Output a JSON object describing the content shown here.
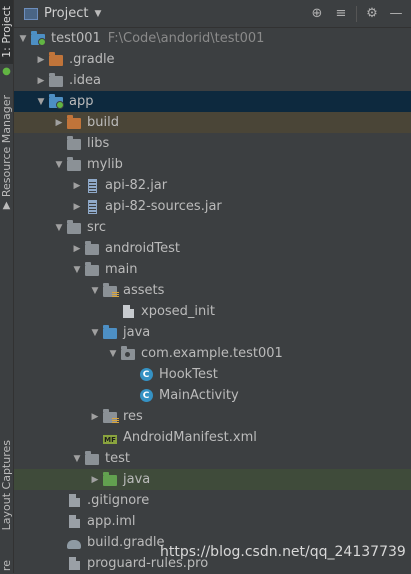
{
  "side_tabs": {
    "project": "1: Project",
    "resource_manager": "Resource Manager",
    "layout_captures": "Layout Captures",
    "bottom_cut": "re"
  },
  "header": {
    "title": "Project"
  },
  "tree": [
    {
      "label": "test001",
      "path": "F:\\Code\\andorid\\test001",
      "depth": 0,
      "arrow": "down",
      "icon": "module-folder-icon",
      "label_class": ""
    },
    {
      "label": ".gradle",
      "depth": 1,
      "arrow": "right",
      "icon": "folder-orange"
    },
    {
      "label": ".idea",
      "depth": 1,
      "arrow": "right",
      "icon": "folder-grey"
    },
    {
      "label": "app",
      "depth": 1,
      "arrow": "down",
      "icon": "module-folder-icon",
      "selected": true
    },
    {
      "label": "build",
      "depth": 2,
      "arrow": "right",
      "icon": "folder-orange",
      "highlight": "brown"
    },
    {
      "label": "libs",
      "depth": 2,
      "arrow": "",
      "icon": "folder-grey"
    },
    {
      "label": "mylib",
      "depth": 2,
      "arrow": "down",
      "icon": "folder-grey"
    },
    {
      "label": "api-82.jar",
      "depth": 3,
      "arrow": "right",
      "icon": "jar"
    },
    {
      "label": "api-82-sources.jar",
      "depth": 3,
      "arrow": "right",
      "icon": "jar"
    },
    {
      "label": "src",
      "depth": 2,
      "arrow": "down",
      "icon": "folder-grey"
    },
    {
      "label": "androidTest",
      "depth": 3,
      "arrow": "right",
      "icon": "folder-grey"
    },
    {
      "label": "main",
      "depth": 3,
      "arrow": "down",
      "icon": "folder-grey"
    },
    {
      "label": "assets",
      "depth": 4,
      "arrow": "down",
      "icon": "folder-assets"
    },
    {
      "label": "xposed_init",
      "depth": 5,
      "arrow": "",
      "icon": "file-light"
    },
    {
      "label": "java",
      "depth": 4,
      "arrow": "down",
      "icon": "folder-blue"
    },
    {
      "label": "com.example.test001",
      "depth": 5,
      "arrow": "down",
      "icon": "package"
    },
    {
      "label": "HookTest",
      "depth": 6,
      "arrow": "",
      "icon": "class"
    },
    {
      "label": "MainActivity",
      "depth": 6,
      "arrow": "",
      "icon": "class"
    },
    {
      "label": "res",
      "depth": 4,
      "arrow": "right",
      "icon": "folder-res"
    },
    {
      "label": "AndroidManifest.xml",
      "depth": 4,
      "arrow": "",
      "icon": "manifest"
    },
    {
      "label": "test",
      "depth": 3,
      "arrow": "down",
      "icon": "folder-grey"
    },
    {
      "label": "java",
      "depth": 4,
      "arrow": "right",
      "icon": "folder-green",
      "highlight": "green"
    },
    {
      "label": ".gitignore",
      "depth": 2,
      "arrow": "",
      "icon": "file"
    },
    {
      "label": "app.iml",
      "depth": 2,
      "arrow": "",
      "icon": "file"
    },
    {
      "label": "build.gradle",
      "depth": 2,
      "arrow": "",
      "icon": "gradle"
    },
    {
      "label": "proguard-rules.pro",
      "depth": 2,
      "arrow": "",
      "icon": "file"
    }
  ],
  "watermark": "https://blog.csdn.net/qq_24137739",
  "colors": {
    "background": "#3c3f41",
    "selection": "#0d293e",
    "folder_blue": "#4d8fc4",
    "folder_orange": "#c0743a",
    "folder_green": "#62a14f",
    "class_icon": "#3592c4"
  }
}
